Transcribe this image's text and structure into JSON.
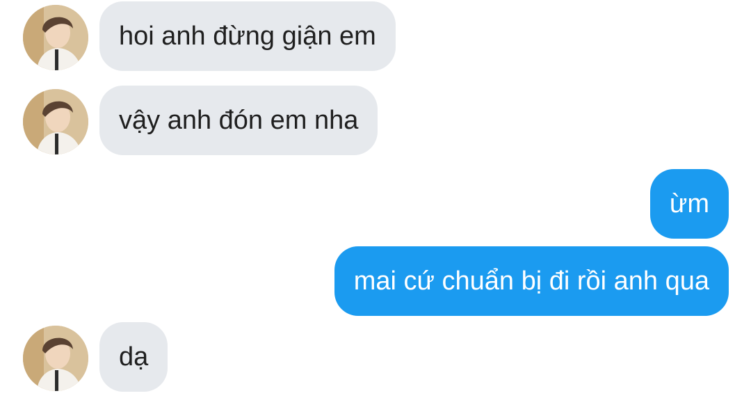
{
  "colors": {
    "incoming_bubble": "#e6e9ed",
    "outgoing_bubble": "#1b9bf0",
    "incoming_text": "#1f1f1f",
    "outgoing_text": "#ffffff"
  },
  "messages": [
    {
      "sender": "contact",
      "text": "hoi anh đừng giận em"
    },
    {
      "sender": "contact",
      "text": "vậy anh đón em nha"
    },
    {
      "sender": "me",
      "text": "ừm"
    },
    {
      "sender": "me",
      "text": "mai cứ chuẩn bị đi rồi anh qua"
    },
    {
      "sender": "contact",
      "text": "dạ"
    }
  ]
}
